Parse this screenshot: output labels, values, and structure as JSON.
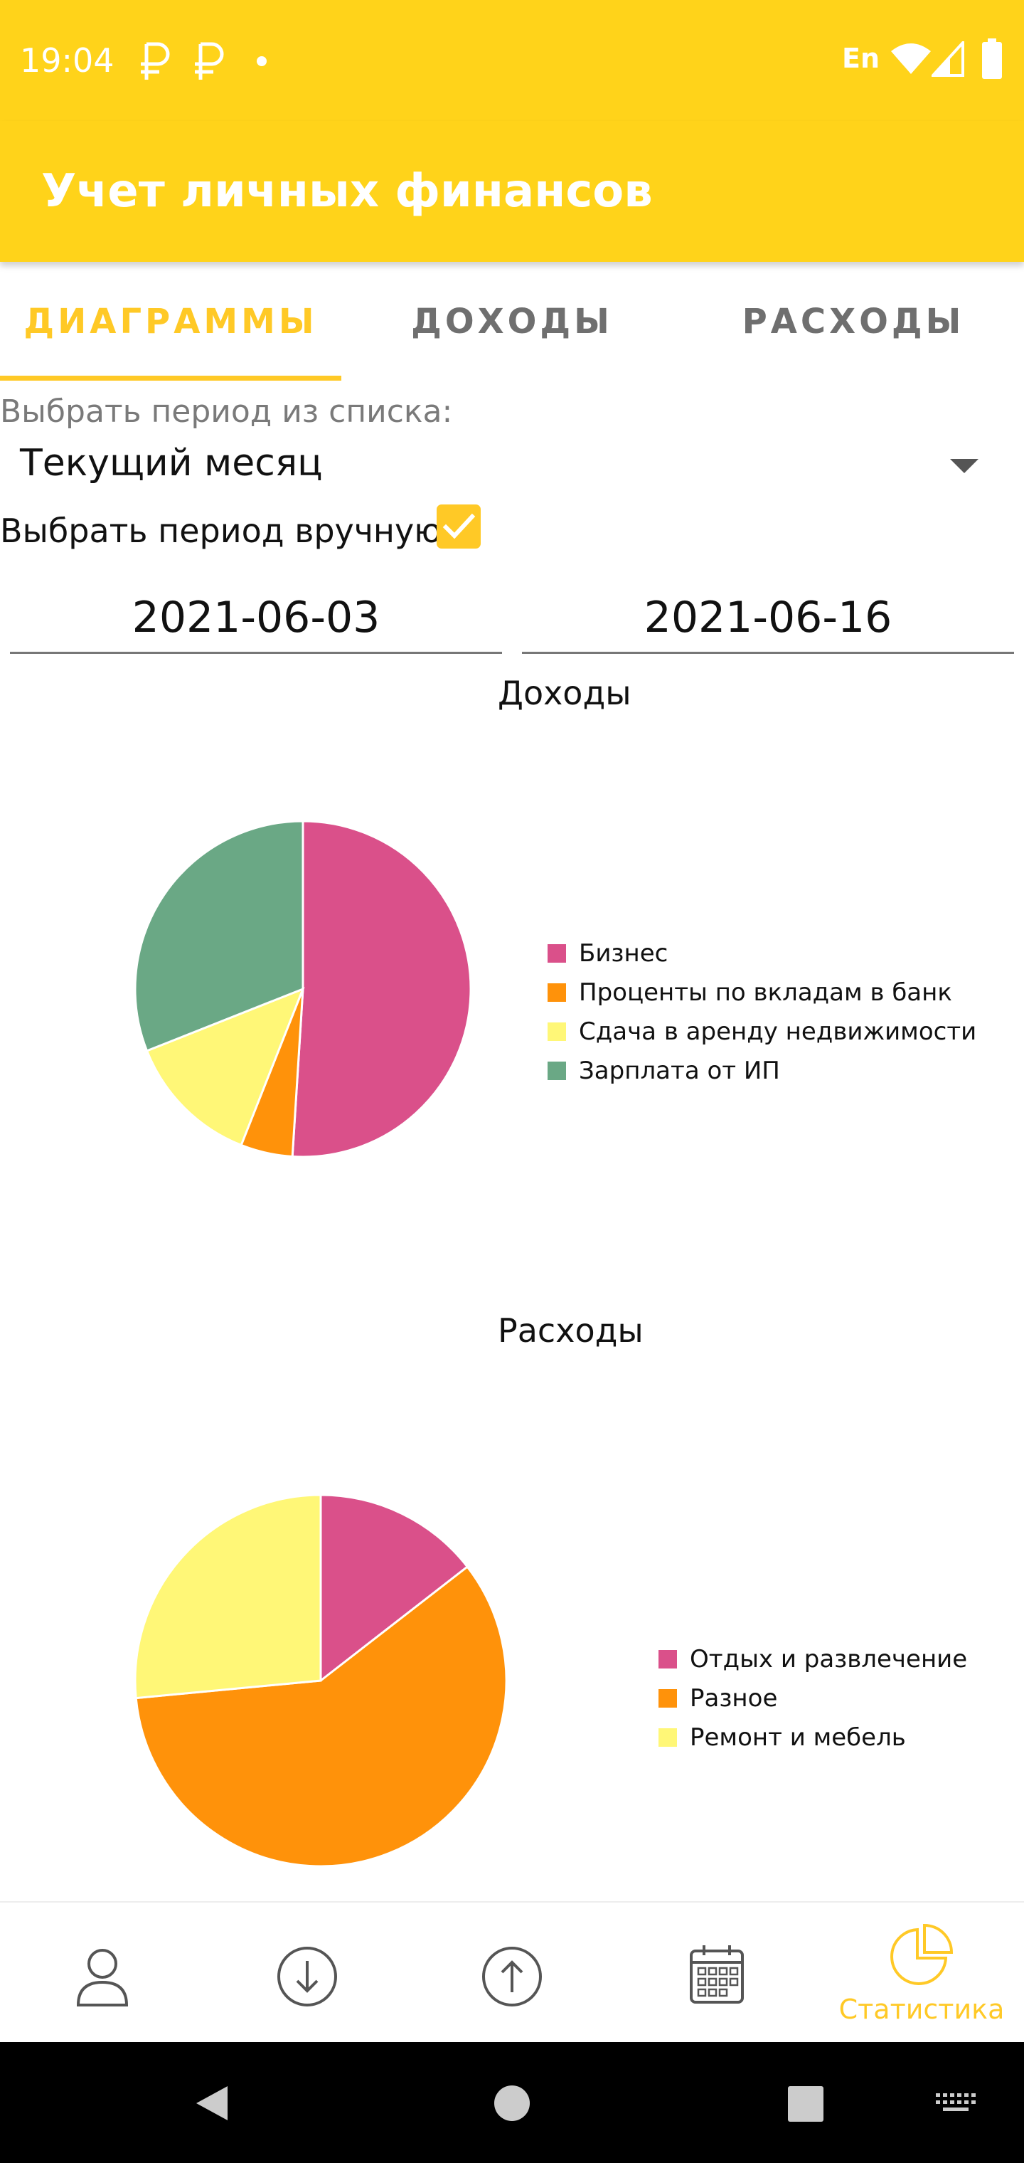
{
  "status_bar": {
    "time": "19:04",
    "notification_icons": [
      "ruble-icon",
      "ruble-icon",
      "dot-icon"
    ],
    "language": "En",
    "system_icons": [
      "wifi-icon",
      "signal-icon",
      "battery-icon"
    ],
    "background": "#FFD31A"
  },
  "app_bar": {
    "title": "Учет личных финансов",
    "background": "#FFD31A"
  },
  "tabs": {
    "items": [
      {
        "label": "ДИАГРАММЫ",
        "active": true
      },
      {
        "label": "ДОХОДЫ",
        "active": false
      },
      {
        "label": "РАСХОДЫ",
        "active": false
      }
    ],
    "accent": "#FFC926"
  },
  "period": {
    "list_label": "Выбрать период из списка:",
    "selected": "Текущий месяц",
    "manual_label": "Выбрать период вручную",
    "manual_checked": true,
    "date_from": "2021-06-03",
    "date_to": "2021-06-16"
  },
  "chart_data": [
    {
      "type": "pie",
      "title": "Доходы",
      "labels": [
        "Бизнес",
        "Проценты по вкладам в банк",
        "Сдача в аренду недвижимости",
        "Зарплата от ИП"
      ],
      "values": [
        51,
        5,
        13,
        31
      ],
      "colors": [
        "#DA508A",
        "#FF920A",
        "#FFF777",
        "#6AA885"
      ]
    },
    {
      "type": "pie",
      "title": "Расходы",
      "labels": [
        "Отдых и развлечение",
        "Разное",
        "Ремонт и мебель"
      ],
      "values": [
        14.5,
        59,
        26.5
      ],
      "colors": [
        "#DA508A",
        "#FF920A",
        "#FFF777"
      ]
    }
  ],
  "bottom_nav": {
    "items": [
      {
        "icon": "person-icon",
        "label": "",
        "active": false
      },
      {
        "icon": "arrow-down-circle-icon",
        "label": "",
        "active": false
      },
      {
        "icon": "arrow-up-circle-icon",
        "label": "",
        "active": false
      },
      {
        "icon": "calendar-icon",
        "label": "",
        "active": false
      },
      {
        "icon": "pie-chart-icon",
        "label": "Статистика",
        "active": true
      }
    ]
  },
  "system_nav": {
    "icons": [
      "back-icon",
      "home-icon",
      "recents-icon",
      "keyboard-icon"
    ]
  }
}
